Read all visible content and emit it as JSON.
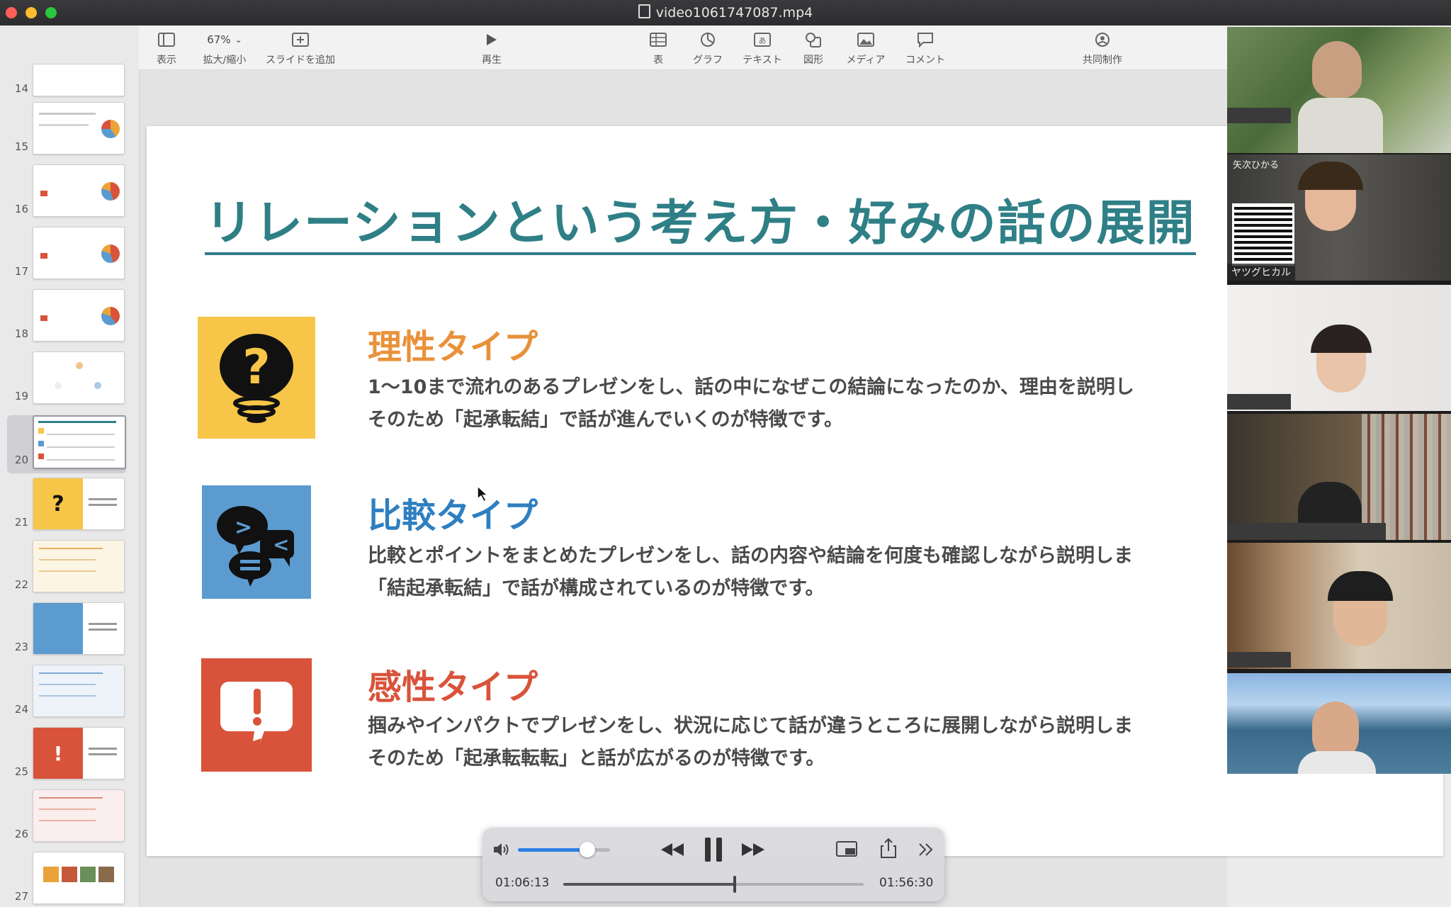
{
  "window": {
    "title": "video1061747087.mp4"
  },
  "toolbar": {
    "zoom_value": "67%",
    "view_label": "表示",
    "zoom_label": "拡大/縮小",
    "add_slide_label": "スライドを追加",
    "play_label": "再生",
    "table_label": "表",
    "chart_label": "グラフ",
    "text_label": "テキスト",
    "shape_label": "図形",
    "media_label": "メディア",
    "comment_label": "コメント",
    "collaborate_label": "共同制作"
  },
  "sidebar": {
    "slides": [
      {
        "num": "14"
      },
      {
        "num": "15"
      },
      {
        "num": "16"
      },
      {
        "num": "17"
      },
      {
        "num": "18"
      },
      {
        "num": "19"
      },
      {
        "num": "20"
      },
      {
        "num": "21"
      },
      {
        "num": "22"
      },
      {
        "num": "23"
      },
      {
        "num": "24"
      },
      {
        "num": "25"
      },
      {
        "num": "26"
      },
      {
        "num": "27"
      }
    ],
    "selected": "20"
  },
  "slide": {
    "title": "リレーションという考え方・好みの話の展開",
    "types": [
      {
        "name": "理性タイプ",
        "color": "#e9913a",
        "icon": "question-bulb-icon",
        "line1": "1〜10まで流れのあるプレゼンをし、話の中になぜこの結論になったのか、理由を説明し",
        "line2": "そのため「起承転結」で話が進んでいくのが特徴です。"
      },
      {
        "name": "比較タイプ",
        "color": "#2f7fc0",
        "icon": "speech-bubbles-icon",
        "line1": "比較とポイントをまとめたプレゼンをし、話の内容や結論を何度も確認しながら説明しま",
        "line2": "「結起承転結」で話が構成されているのが特徴です。"
      },
      {
        "name": "感性タイプ",
        "color": "#d9533a",
        "icon": "exclamation-bubble-icon",
        "line1": "掴みやインパクトでプレゼンをし、状況に応じて話が違うところに展開しながら説明しま",
        "line2": "そのため「起承転転転」と話が広がるのが特徴です。"
      }
    ]
  },
  "participants": [
    {
      "name": ""
    },
    {
      "name": "ヤツグヒカル",
      "overlay": "矢次ひかる"
    },
    {
      "name": ""
    },
    {
      "name": ""
    },
    {
      "name": ""
    },
    {
      "name": ""
    }
  ],
  "player": {
    "elapsed": "01:06:13",
    "total": "01:56:30",
    "volume": 0.75,
    "progress": 0.57
  },
  "colors": {
    "accent": "#2f7f86",
    "yellow": "#f7c548",
    "blue": "#5b9bd0",
    "red": "#d9533a"
  }
}
